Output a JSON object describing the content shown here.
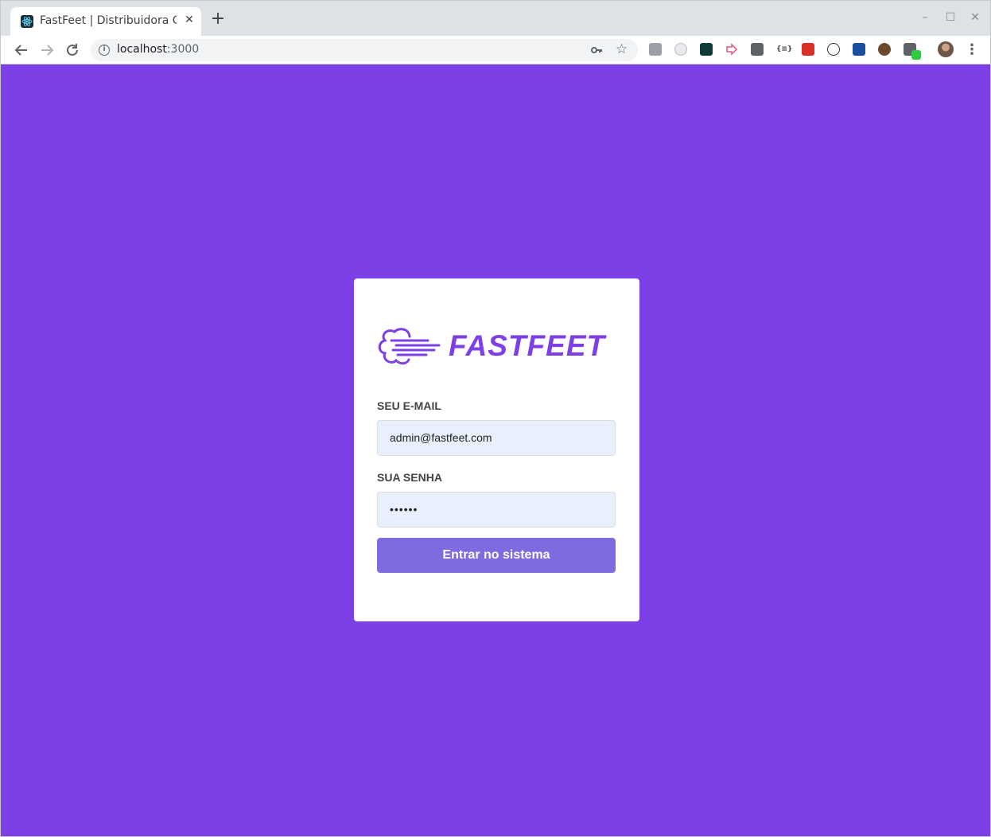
{
  "browser": {
    "tab_title": "FastFeet | Distribuidora Q",
    "tab_close": "✕",
    "new_tab": "+",
    "url_host": "localhost",
    "url_port": ":3000",
    "window_controls": {
      "minimize": "–",
      "maximize": "☐",
      "close": "✕"
    },
    "extension_icons": [
      "camera-icon",
      "timer-icon",
      "m-extension-icon",
      "arrow-extension-icon",
      "bracket-extension-icon",
      "json-viewer-icon",
      "colorzilla-icon",
      "ghost-icon",
      "screen-icon",
      "cookie-icon",
      "eyedropper-icon"
    ]
  },
  "login": {
    "brand": "FASTFEET",
    "email_label": "SEU E-MAIL",
    "email_value": "admin@fastfeet.com",
    "password_label": "SUA SENHA",
    "password_value": "••••••",
    "submit_label": "Entrar no sistema"
  },
  "colors": {
    "primary": "#7d40e7",
    "button": "#7d6ce0",
    "input_bg": "#e8f0fe"
  }
}
